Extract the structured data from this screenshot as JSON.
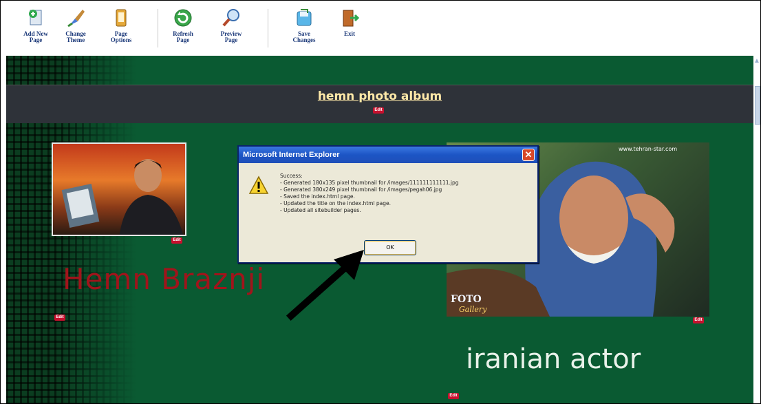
{
  "toolbar": {
    "buttons": [
      {
        "label_line1": "Add New",
        "label_line2": "Page",
        "icon": "add-page-icon"
      },
      {
        "label_line1": "Change",
        "label_line2": "Theme",
        "icon": "brush-icon"
      },
      {
        "label_line1": "Page",
        "label_line2": "Options",
        "icon": "page-options-icon"
      },
      {
        "label_line1": "Refresh",
        "label_line2": "Page",
        "icon": "refresh-icon"
      },
      {
        "label_line1": "Preview",
        "label_line2": "Page",
        "icon": "magnifier-icon"
      },
      {
        "label_line1": "Save",
        "label_line2": "Changes",
        "icon": "save-icon"
      },
      {
        "label_line1": "Exit",
        "label_line2": "",
        "icon": "exit-door-icon"
      }
    ]
  },
  "page": {
    "site_title": "hemn photo album",
    "name_text": "Hemn Braznji",
    "caption_text": "iranian actor",
    "edit_label": "Edit",
    "watermark": "www.tehran-star.com",
    "photo_logo_line1": "FOTO",
    "photo_logo_line2": "Gallery",
    "colors": {
      "background": "#0a5a32",
      "title_band": "#2e3239",
      "title_text": "#ffe9a8",
      "name_text": "#a1141b",
      "caption_text": "#e9f2ea"
    }
  },
  "dialog": {
    "title": "Microsoft Internet Explorer",
    "close_symbol": "✕",
    "icon": "warning-icon",
    "lines": [
      "Success:",
      "- Generated 180x135 pixel thumbnail for /images/111111111111.jpg",
      "- Generated 380x249 pixel thumbnail for /images/pegah06.jpg",
      "- Saved the index.html page.",
      "- Updated the title on the index.html page.",
      "- Updated all sitebuilder pages."
    ],
    "ok_label": "OK"
  }
}
